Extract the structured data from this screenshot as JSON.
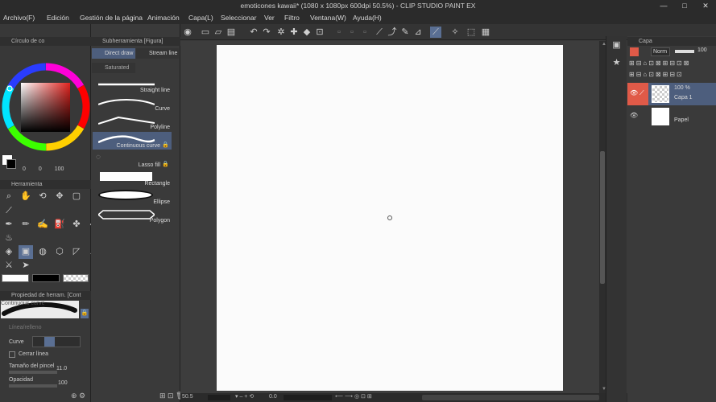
{
  "window": {
    "title": "emoticones kawaii* (1080 x 1080px 600dpi 50.5%) - CLIP STUDIO PAINT EX",
    "controls": [
      "—",
      "□",
      "✕"
    ]
  },
  "menu": [
    "Archivo(F)",
    "Edición",
    "Gestión de la página",
    "Animación",
    "Capa(L)",
    "Seleccionar",
    "Ver",
    "Filtro",
    "Ventana(W)",
    "Ayuda(H)"
  ],
  "color_panel": {
    "title": "Círculo de co",
    "values": [
      "0",
      "0",
      "100"
    ],
    "colors": {
      "main": "#000000",
      "sub": "#ffffff",
      "hue_ring_accent": "#e0231e"
    }
  },
  "subtool_panel": {
    "title": "Subherramienta [Figura]",
    "tabs": [
      "Direct draw",
      "Stream line",
      "Saturated"
    ],
    "items": [
      {
        "label": "Straight line"
      },
      {
        "label": "Curve"
      },
      {
        "label": "Polyline"
      },
      {
        "label": "Continuous curve",
        "selected": true
      },
      {
        "label": "Lasso fill"
      },
      {
        "label": "Rectangle"
      },
      {
        "label": "Ellipse"
      },
      {
        "label": "Polygon"
      }
    ]
  },
  "tools_panel": {
    "title": "Herramienta",
    "icons": [
      "magnifier-icon",
      "hand-icon",
      "rotate-icon",
      "move-icon",
      "selection-icon",
      "magic-wand-icon",
      "eyedropper-icon",
      "pen-icon",
      "pencil-icon",
      "brush-icon",
      "airbrush-icon",
      "decoration-icon",
      "eraser-icon",
      "blend-icon",
      "fill-icon",
      "figure-icon",
      "gradient-icon",
      "frame-icon",
      "ruler-icon",
      "text-icon",
      "balloon-icon",
      "correct-line-icon"
    ]
  },
  "tool_property": {
    "title": "Propiedad de herram. [Cont",
    "preview_label": "Continuous curve",
    "line_fill": "Línea/relleno",
    "curve_label": "Curve",
    "close_line_label": "Cerrar línea",
    "brush_size_label": "Tamaño del pincel",
    "brush_size_value": "11.0",
    "opacity_label": "Opacidad",
    "opacity_value": "100"
  },
  "layer_panel": {
    "title": "Capa",
    "blend_mode": "Norm",
    "opacity": "100",
    "layers": [
      {
        "opacity": "100 %",
        "name": "Capa 1",
        "selected": true
      },
      {
        "name": "Papel"
      }
    ]
  },
  "status_bar": {
    "zoom": "50.5",
    "angle": "0.0"
  }
}
